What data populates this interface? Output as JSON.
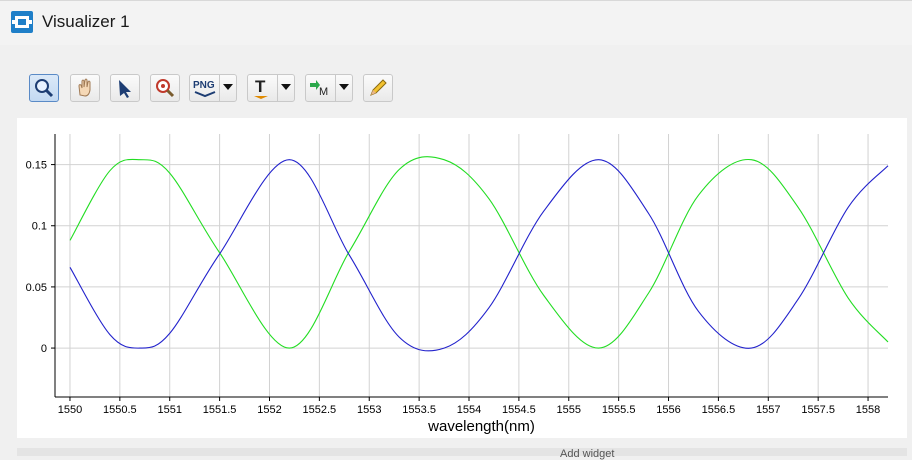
{
  "window": {
    "title": "Visualizer 1"
  },
  "toolbar": {
    "png_label": "PNG",
    "text_tool_glyph": "T",
    "marker_glyph": "M",
    "buttons": [
      {
        "name": "zoom-tool",
        "icon": "magnifier-icon",
        "active": true
      },
      {
        "name": "pan-tool",
        "icon": "hand-icon"
      },
      {
        "name": "select-tool",
        "icon": "arrow-cursor-icon"
      },
      {
        "name": "zoom-reset-tool",
        "icon": "magnifier-target-icon"
      },
      {
        "name": "export-png",
        "icon": "png-icon",
        "dropdown": true
      },
      {
        "name": "text-tool",
        "icon": "text-t-icon",
        "dropdown": true
      },
      {
        "name": "marker-tool",
        "icon": "marker-icon",
        "dropdown": true
      },
      {
        "name": "edit-tool",
        "icon": "pencil-icon"
      }
    ]
  },
  "chart_data": {
    "type": "line",
    "title": "",
    "xlabel": "wavelength(nm)",
    "ylabel": "",
    "xlim": [
      1549.85,
      1558.2
    ],
    "ylim": [
      -0.04,
      0.175
    ],
    "grid": true,
    "x_ticks": [
      "1550",
      "1550.5",
      "1551",
      "1551.5",
      "1552",
      "1552.5",
      "1553",
      "1553.5",
      "1554",
      "1554.5",
      "1555",
      "1555.5",
      "1556",
      "1556.5",
      "1557",
      "1557.5",
      "1558"
    ],
    "y_ticks": [
      "0",
      "0.05",
      "0.1",
      "0.15"
    ],
    "series": [
      {
        "color": "#22dd22",
        "x": [
          1550,
          1550.4,
          1550.7,
          1551,
          1551.5,
          1552.2,
          1552.8,
          1553.3,
          1553.75,
          1554.2,
          1554.75,
          1555.3,
          1555.8,
          1556.3,
          1556.83,
          1557.3,
          1557.8,
          1558.2
        ],
        "y": [
          0.088,
          0.145,
          0.154,
          0.143,
          0.078,
          0.0,
          0.079,
          0.146,
          0.154,
          0.122,
          0.043,
          0.0,
          0.045,
          0.125,
          0.154,
          0.115,
          0.041,
          0.005
        ]
      },
      {
        "color": "#2222cc",
        "x": [
          1550,
          1550.4,
          1550.7,
          1551,
          1551.5,
          1552.2,
          1552.8,
          1553.3,
          1553.75,
          1554.2,
          1554.75,
          1555.3,
          1555.8,
          1556.3,
          1556.83,
          1557.3,
          1557.8,
          1558.2
        ],
        "y": [
          0.066,
          0.011,
          0.0,
          0.012,
          0.077,
          0.154,
          0.076,
          0.009,
          0.0,
          0.033,
          0.112,
          0.154,
          0.11,
          0.03,
          0.0,
          0.04,
          0.115,
          0.149
        ]
      }
    ]
  },
  "status": {
    "fragment": "Add widget"
  }
}
